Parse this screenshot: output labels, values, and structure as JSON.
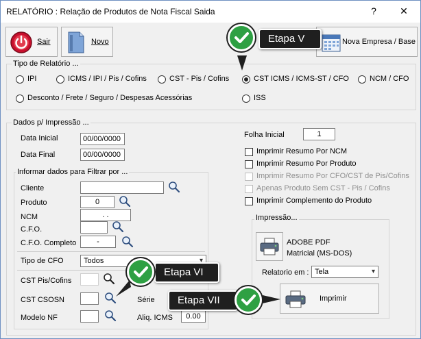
{
  "window": {
    "title": "RELATÓRIO : Relação de Produtos de Nota Fiscal Saida",
    "help": "?",
    "close": "✕"
  },
  "toolbar": {
    "exit_label": "Sair",
    "new_label": "Novo",
    "new_company_label": "Nova Empresa / Base"
  },
  "report_type": {
    "group_label": "Tipo de Relatório ...",
    "options": [
      {
        "label": "IPI",
        "selected": false
      },
      {
        "label": "ICMS / IPI / Pis / Cofins",
        "selected": false
      },
      {
        "label": "CST - Pis / Cofins",
        "selected": false
      },
      {
        "label": "CST ICMS  /  ICMS-ST / CFO",
        "selected": true
      },
      {
        "label": "NCM / CFO",
        "selected": false
      },
      {
        "label": "Desconto / Frete / Seguro / Despesas Acessórias",
        "selected": false
      },
      {
        "label": "ISS",
        "selected": false
      }
    ]
  },
  "print_data": {
    "group_label": "Dados p/ Impressão ...",
    "start_date_label": "Data Inicial",
    "start_date_value": "00/00/0000",
    "end_date_label": "Data Final",
    "end_date_value": "00/00/0000",
    "start_page_label": "Folha Inicial",
    "start_page_value": "1",
    "checkboxes": [
      {
        "label": "Imprimir Resumo Por NCM",
        "enabled": true
      },
      {
        "label": "Imprimir Resumo Por Produto",
        "enabled": true
      },
      {
        "label": "Imprimir Resumo Por CFO/CST de Pis/Cofins",
        "enabled": false
      },
      {
        "label": "Apenas Produto Sem CST - Pis / Cofins",
        "enabled": false
      },
      {
        "label": "Imprimir Complemento do Produto",
        "enabled": true
      }
    ]
  },
  "filter": {
    "group_label": "Informar dados para Filtrar por ...",
    "client_label": "Cliente",
    "client_value": "",
    "product_label": "Produto",
    "product_value": "0",
    "ncm_label": "NCM",
    "ncm_value": ". .",
    "cfo_label": "C.F.O.",
    "cfo_value": "",
    "cfo_full_label": "C.F.O. Completo",
    "cfo_full_value": "-",
    "cfo_type_label": "Tipo de CFO",
    "cfo_type_value": "Todos",
    "cst_pis_label": "CST Pis/Cofins",
    "cst_pis_value": "",
    "cst_csosn_label": "CST CSOSN",
    "cst_csosn_value": "",
    "series_label": "Série",
    "model_label": "Modelo NF",
    "model_value": "",
    "icms_rate_label": "Aliq. ICMS",
    "icms_rate_value": "0.00"
  },
  "printing": {
    "group_label": "Impressão...",
    "printer_line1": "ADOBE PDF",
    "printer_line2": "Matricial (MS-DOS)",
    "report_in_label": "Relatorio em :",
    "report_in_value": "Tela",
    "print_label": "Imprimir"
  },
  "callouts": {
    "step5": "Etapa V",
    "step6": "Etapa VI",
    "step7": "Etapa VII"
  },
  "colors": {
    "accent_green": "#2ea043",
    "callout_bg": "#1f1f1f",
    "window_bg": "#f0f0f0"
  }
}
